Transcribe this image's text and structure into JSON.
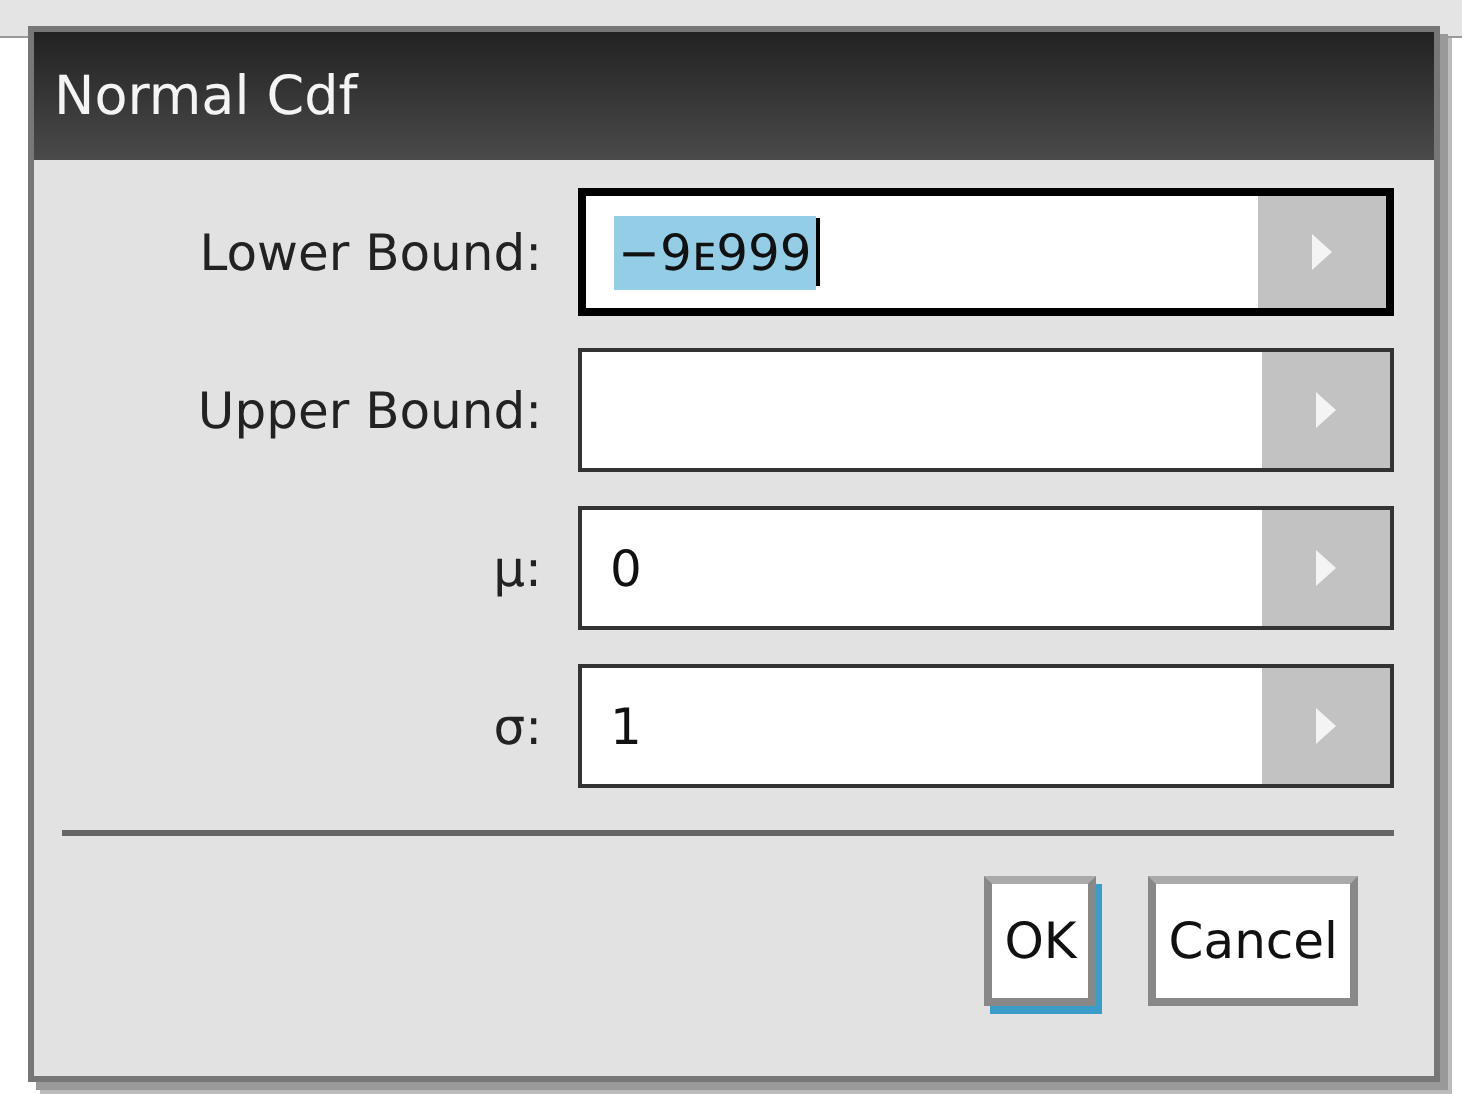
{
  "dialog": {
    "title": "Normal Cdf",
    "fields": [
      {
        "label": "Lower Bound:",
        "value": "−9ᴇ999",
        "focused": true
      },
      {
        "label": "Upper Bound:",
        "focused": false
      },
      {
        "label": "μ:",
        "value": "0",
        "focused": false
      },
      {
        "label": "σ:",
        "value": "1",
        "focused": false
      }
    ],
    "buttons": [
      {
        "label": "OK",
        "focused": true
      },
      {
        "label": "Cancel",
        "focused": false
      }
    ]
  }
}
